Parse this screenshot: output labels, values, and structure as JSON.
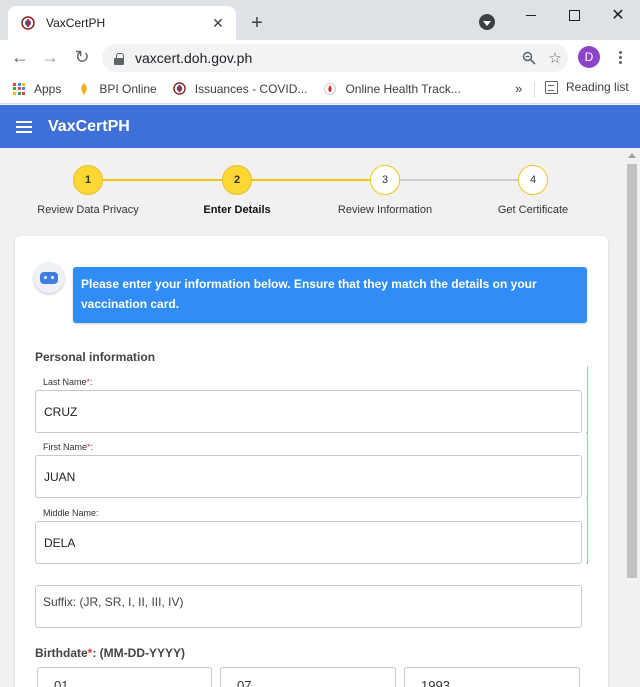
{
  "browser": {
    "tab_title": "VaxCertPH",
    "tab_close": "✕",
    "new_tab": "+",
    "url": "vaxcert.doh.gov.ph",
    "profile_initial": "D",
    "bookmarks": [
      "Apps",
      "BPI Online",
      "Issuances - COVID...",
      "Online Health Track..."
    ],
    "bookmarks_more": "»",
    "reading_list": "Reading list"
  },
  "app": {
    "title": "VaxCertPH"
  },
  "stepper": {
    "steps": [
      {
        "number": "1",
        "label": "Review Data Privacy",
        "state": "done"
      },
      {
        "number": "2",
        "label": "Enter Details",
        "state": "active"
      },
      {
        "number": "3",
        "label": "Review Information",
        "state": "todo"
      },
      {
        "number": "4",
        "label": "Get Certificate",
        "state": "todo"
      }
    ],
    "colors": {
      "done": "#fdd835",
      "line": "#f5c518",
      "pending_line": "#cccccc"
    }
  },
  "form": {
    "notice": "Please enter your information below. Ensure that they match the details on your vaccination card.",
    "section_title": "Personal information",
    "required_mark": "*",
    "last_name": {
      "label": "Last Name",
      "value": "CRUZ"
    },
    "first_name": {
      "label": "First Name",
      "value": "JUAN"
    },
    "middle_name": {
      "label": "Middle Name:",
      "value": "DELA"
    },
    "suffix": {
      "placeholder": "Suffix: (JR, SR, I, II, III, IV)"
    },
    "birthdate": {
      "label": "Birthdate",
      "format": ": (MM-DD-YYYY)",
      "month": "01",
      "day": "07",
      "year": "1993"
    }
  },
  "colors": {
    "header": "#3f6fd8",
    "notice_bg": "#2f8df5",
    "required": "#e53935"
  }
}
